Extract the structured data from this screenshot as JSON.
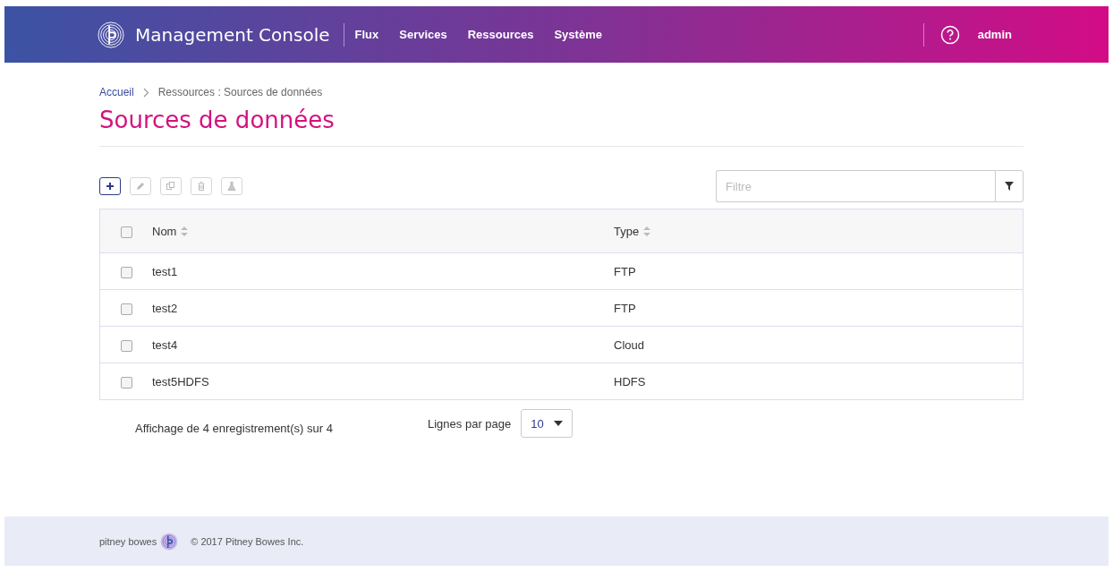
{
  "header": {
    "title": "Management Console",
    "nav": [
      {
        "label": "Flux"
      },
      {
        "label": "Services"
      },
      {
        "label": "Ressources"
      },
      {
        "label": "Système"
      }
    ],
    "user": "admin"
  },
  "breadcrumb": {
    "home": "Accueil",
    "current": "Ressources : Sources de données"
  },
  "page_title": "Sources de données",
  "toolbar": [
    {
      "kind": "add",
      "disabled": false
    },
    {
      "kind": "edit",
      "disabled": true
    },
    {
      "kind": "copy",
      "disabled": true
    },
    {
      "kind": "delete",
      "disabled": true
    },
    {
      "kind": "test",
      "disabled": true
    }
  ],
  "filter": {
    "placeholder": "Filtre"
  },
  "table": {
    "select_all": {
      "checked": false
    },
    "columns": [
      "Nom",
      "Type"
    ],
    "rows": [
      {
        "checked": false,
        "cells": [
          "test1",
          "FTP"
        ]
      },
      {
        "checked": false,
        "cells": [
          "test2",
          "FTP"
        ]
      },
      {
        "checked": false,
        "cells": [
          "test4",
          "Cloud"
        ]
      },
      {
        "checked": false,
        "cells": [
          "test5HDFS",
          "HDFS"
        ]
      }
    ]
  },
  "pager": {
    "summary": "Affichage de 4 enregistrement(s) sur 4",
    "rows_label": "Lignes par page",
    "rows_value": "10"
  },
  "footer": {
    "brand": "pitney bowes",
    "copyright": "© 2017 Pitney Bowes Inc."
  }
}
